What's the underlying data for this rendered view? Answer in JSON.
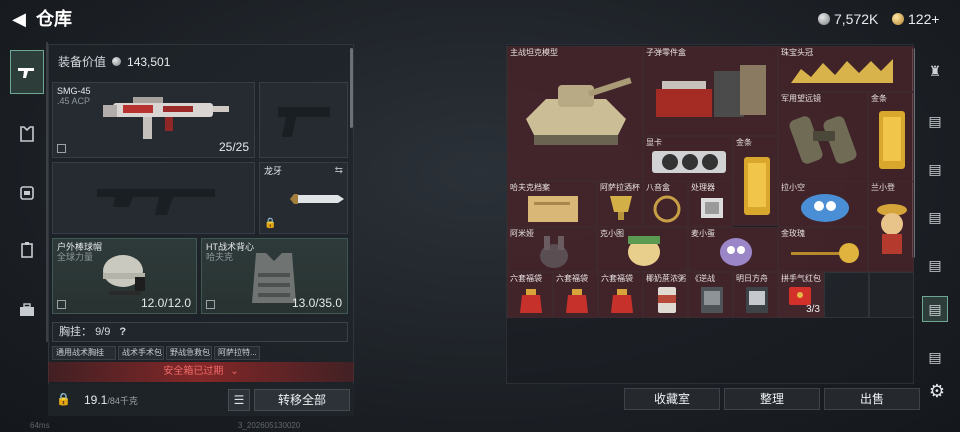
{
  "header": {
    "title": "仓库",
    "currency_silver": "7,572K",
    "currency_gold": "122+"
  },
  "equipment": {
    "value_label": "装备价值",
    "value": "143,501",
    "weapon_slot": {
      "name": "SMG-45",
      "ammo": ".45 ACP",
      "count": "25/25"
    },
    "knife_slot": {
      "name": "龙牙"
    },
    "helmet_slot": {
      "name": "户外棒球帽",
      "sub": "全球力量",
      "count": "12.0/12.0"
    },
    "armor_slot": {
      "name": "HT战术背心",
      "sub": "哈夫克",
      "count": "13.0/35.0"
    },
    "chest_label": "胸挂：",
    "chest_count": "9/9",
    "chest_help": "?",
    "tags": [
      "通用战术胸挂",
      "战术手术包",
      "野战急救包",
      "阿萨拉特..."
    ],
    "warning": "安全箱已过期",
    "weight": "19.1",
    "weight_unit": "/84千克",
    "transfer_all": "转移全部"
  },
  "warehouse": {
    "items": [
      {
        "name": "主战坦克模型"
      },
      {
        "name": "子弹零件盒"
      },
      {
        "name": "珠宝头冠"
      },
      {
        "name": "显卡"
      },
      {
        "name": "军用望远镜"
      },
      {
        "name": "金条"
      },
      {
        "name": "金条"
      },
      {
        "name": "哈夫克档案"
      },
      {
        "name": "阿萨拉酒杯"
      },
      {
        "name": "八音盒"
      },
      {
        "name": "处理器"
      },
      {
        "name": "拉小空"
      },
      {
        "name": "兰小登"
      },
      {
        "name": "阿米娅"
      },
      {
        "name": "克小图"
      },
      {
        "name": "麦小蛋"
      },
      {
        "name": "金玫瑰"
      },
      {
        "name": "六套福袋"
      },
      {
        "name": "六套福袋"
      },
      {
        "name": "六套福袋"
      },
      {
        "name": "椰奶蔗浓粥"
      },
      {
        "name": "《逆战"
      },
      {
        "name": "明日方舟"
      },
      {
        "name": "拼手气红包",
        "count": "3/3"
      }
    ]
  },
  "bottom_buttons": {
    "collection": "收藏室",
    "organize": "整理",
    "sell": "出售"
  },
  "footer": {
    "ping": "64ms",
    "version": "3_202605130020"
  },
  "colors": {
    "item_bg": "#5f282d",
    "accent_green": "#6ea893",
    "warning_red": "#f06a6a"
  }
}
